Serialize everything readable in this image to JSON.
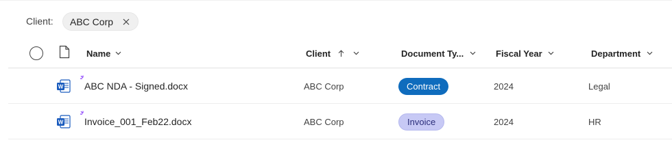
{
  "filter": {
    "label": "Client:",
    "chip_value": "ABC Corp",
    "chip_close_icon": "close-icon"
  },
  "columns": {
    "name": "Name",
    "client": "Client",
    "doc_type": "Document Ty...",
    "fiscal_year": "Fiscal Year",
    "department": "Department"
  },
  "rows": [
    {
      "name": "ABC NDA - Signed.docx",
      "client": "ABC Corp",
      "doc_type": "Contract",
      "fiscal_year": "2024",
      "department": "Legal"
    },
    {
      "name": "Invoice_001_Feb22.docx",
      "client": "ABC Corp",
      "doc_type": "Invoice",
      "fiscal_year": "2024",
      "department": "HR"
    }
  ],
  "colors": {
    "contract_pill": "#0f6cbd",
    "invoice_pill": "#c7c9f5",
    "word_blue": "#185abd",
    "sparkle_purple": "#8a3ffc"
  }
}
